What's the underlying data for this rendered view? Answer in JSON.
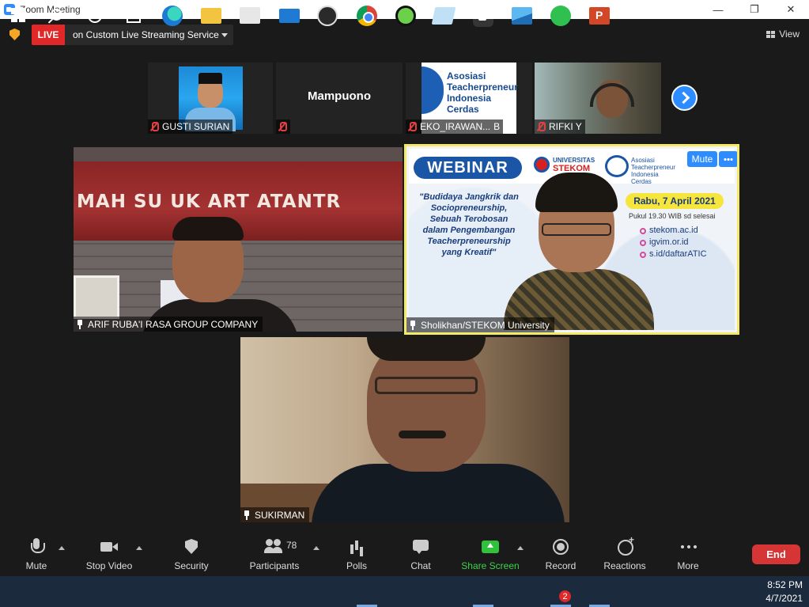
{
  "window": {
    "title": "Zoom Meeting"
  },
  "topbar": {
    "live_label": "LIVE",
    "stream_service": "on Custom Live Streaming Service",
    "view_label": "View"
  },
  "thumbnails": [
    {
      "name": "GUSTI SURIAN",
      "muted": true
    },
    {
      "name": "Mampuono",
      "muted": true
    },
    {
      "name": "EKO_IRAWAN...",
      "name_suffix": "B",
      "muted": true,
      "poster_text": [
        "Asosiasi",
        "Teacherpreneur",
        "Indonesia",
        "Cerdas"
      ]
    },
    {
      "name": "RIFKI Y",
      "muted": true
    }
  ],
  "tiles": {
    "arif": {
      "name": "ARIF RUBA'I RASA GROUP COMPANY",
      "sign_text": "MAH SU  UK ART  ATANTR"
    },
    "sholikhan": {
      "name": "Sholikhan/STEKOM University",
      "mute_button": "Mute",
      "more_button": "···",
      "poster": {
        "webinar": "WEBINAR",
        "university_line1": "UNIVERSITAS",
        "university_line2": "STEKOM",
        "atic_text": "Asosiasi Teacherpreneur Indonesia Cerdas",
        "quote": "\"Budidaya Jangkrik dan Sociopreneurship, Sebuah Terobosan dalam Pengembangan Teacherpreneurship yang Kreatif\"",
        "date": "Rabu, 7 April 2021",
        "time": "Pukul 19.30 WIB sd selesai",
        "links": [
          "stekom.ac.id",
          "igvim.or.id",
          "s.id/daftarATIC"
        ]
      }
    },
    "sukirman": {
      "name": "SUKIRMAN"
    }
  },
  "toolbar": {
    "mute": "Mute",
    "stop_video": "Stop Video",
    "security": "Security",
    "participants": "Participants",
    "participants_count": "78",
    "polls": "Polls",
    "chat": "Chat",
    "share_screen": "Share Screen",
    "record": "Record",
    "reactions": "Reactions",
    "more": "More",
    "end": "End"
  },
  "taskbar": {
    "whatsapp_badge": "2",
    "time": "8:52 PM",
    "date": "4/7/2021"
  },
  "colors": {
    "zoom_blue": "#2d8cff",
    "live_red": "#e02828",
    "share_green": "#2fc23a",
    "active_speaker_border": "#f5e96a",
    "end_red": "#d63535"
  }
}
